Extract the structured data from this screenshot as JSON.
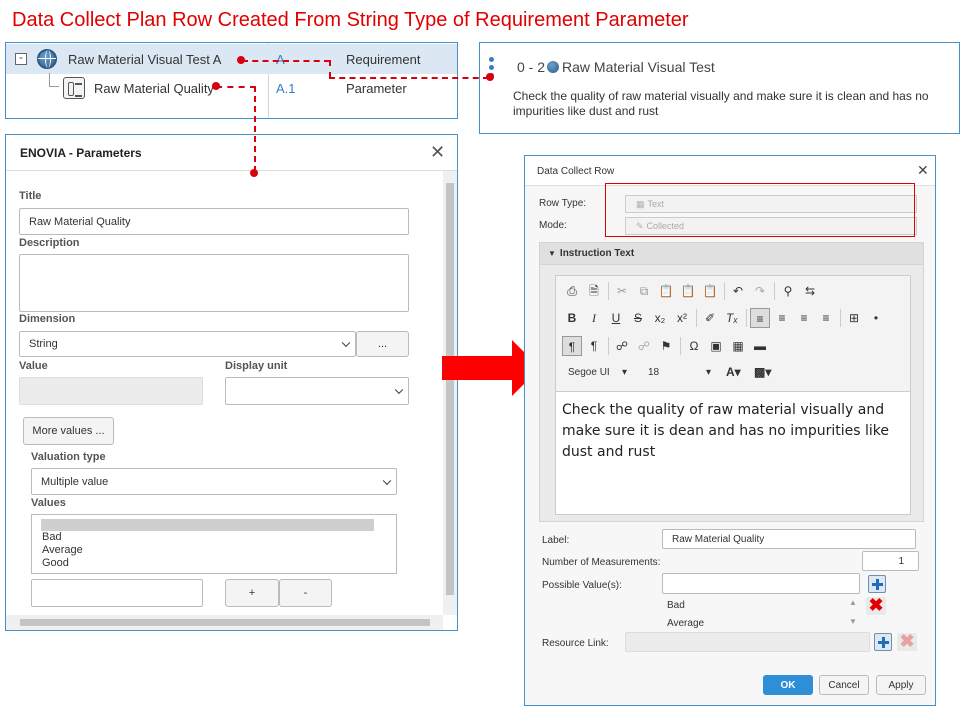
{
  "headline": "Data Collect Plan Row Created From String Type of Requirement Parameter",
  "tree": {
    "rows": [
      {
        "name": "Raw Material Visual Test A",
        "revision": "A",
        "type": "Requirement"
      },
      {
        "name": "Raw Material Quality",
        "revision": "A.1",
        "type": "Parameter"
      }
    ]
  },
  "requirement": {
    "id": "0 - 2",
    "name": "Raw Material Visual Test",
    "description": "Check the quality of raw material visually and make sure it is clean and has no impurities like dust and rust"
  },
  "params_dialog": {
    "title": "ENOVIA - Parameters",
    "title_label": "Title",
    "title_value": "Raw Material Quality",
    "description_label": "Description",
    "description_value": "",
    "dimension_label": "Dimension",
    "dimension_value": "String",
    "dimension_button": "...",
    "value_label": "Value",
    "value_value": "",
    "display_unit_label": "Display unit",
    "display_unit_value": "",
    "more_values_button": "More values ...",
    "valuation_type_label": "Valuation type",
    "valuation_type_value": "Multiple value",
    "values_label": "Values",
    "values": [
      "Bad",
      "Average",
      "Good"
    ],
    "new_value": "",
    "add_button": "+",
    "remove_button": "-"
  },
  "dcr_dialog": {
    "title": "Data Collect Row",
    "row_type_label": "Row Type:",
    "row_type_value": "Text",
    "mode_label": "Mode:",
    "mode_value": "Collected",
    "instruction_label": "Instruction Text",
    "font_name": "Segoe UI",
    "font_size": "18",
    "instruction_text": "Check the quality of raw material visually and make sure it is dean and has no impurities like dust and rust",
    "label_label": "Label:",
    "label_value": "Raw Material Quality",
    "num_measurements_label": "Number of Measurements:",
    "num_measurements_value": "1",
    "possible_values_label": "Possible Value(s):",
    "possible_values_input": "",
    "possible_values": [
      "Bad",
      "Average"
    ],
    "resource_link_label": "Resource Link:",
    "resource_link_value": "",
    "ok_button": "OK",
    "cancel_button": "Cancel",
    "apply_button": "Apply"
  },
  "colors": {
    "headline": "#e00000",
    "connector": "#d8000c",
    "panel_border": "#4a90c8",
    "ok_button": "#2f8ed8"
  },
  "icons": [
    "collapse-icon",
    "globe-icon",
    "parameter-icon",
    "more-dots-icon",
    "close-icon",
    "arrow-right-icon",
    "plus-icon",
    "delete-icon"
  ]
}
